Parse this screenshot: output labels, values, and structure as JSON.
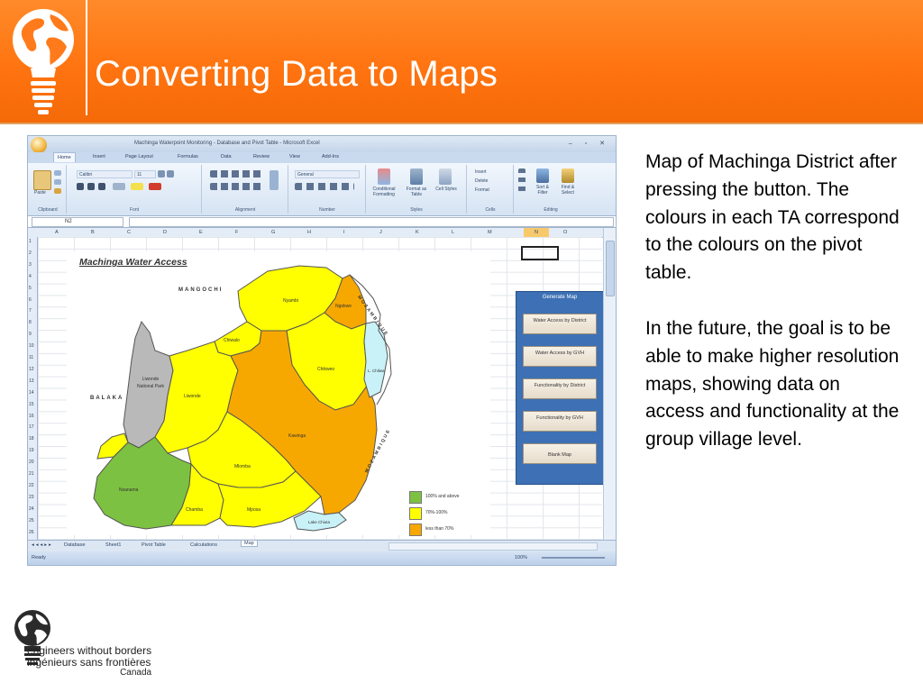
{
  "slide": {
    "title": "Converting Data to Maps",
    "header_color": "#ff7a1a",
    "description_paragraphs": [
      "Map of Machinga District after pressing the button. The colours in each TA correspond to the colours on the pivot table.",
      "In the future, the goal is to be able to make higher resolution maps, showing data on access and functionality at the group village level."
    ]
  },
  "screenshot": {
    "window_title": "Machinga Waterpoint Monitoring - Database and Pivot Table - Microsoft Excel",
    "ribbon_tabs": [
      "Home",
      "Insert",
      "Page Layout",
      "Formulas",
      "Data",
      "Review",
      "View",
      "Add-Ins"
    ],
    "ribbon_groups": [
      "Clipboard",
      "Font",
      "Alignment",
      "Number",
      "Styles",
      "Cells",
      "Editing"
    ],
    "ribbon_buttons": {
      "paste": "Paste",
      "font_name": "Calibri",
      "font_size": "11",
      "number_format": "General",
      "conditional_formatting": "Conditional Formatting",
      "format_as_table": "Format as Table",
      "cell_styles": "Cell Styles",
      "insert": "Insert",
      "delete": "Delete",
      "format": "Format",
      "sort_filter": "Sort & Filter",
      "find_select": "Find & Select"
    },
    "name_box": "N2",
    "columns": [
      "A",
      "B",
      "C",
      "D",
      "E",
      "F",
      "G",
      "H",
      "I",
      "J",
      "K",
      "L",
      "M",
      "N",
      "O"
    ],
    "rows": [
      "1",
      "2",
      "3",
      "4",
      "5",
      "6",
      "7",
      "8",
      "9",
      "10",
      "11",
      "12",
      "13",
      "14",
      "15",
      "16",
      "17",
      "18",
      "19",
      "20",
      "21",
      "22",
      "23",
      "24",
      "25",
      "26"
    ],
    "sheet_tabs": [
      "Database",
      "Sheet1",
      "Pivot Table",
      "Calculations",
      "Map"
    ],
    "active_sheet": "Map",
    "status_left": "Ready",
    "zoom": "100%",
    "map": {
      "title": "Machinga Water Access",
      "regions": [
        "Nyambi",
        "Ngokwe",
        "Chiwalo",
        "Chikweo",
        "Liwonde National Park",
        "Liwonde",
        "Kawinga",
        "Mlomba",
        "Nsanama",
        "Chamba",
        "Mposa"
      ],
      "lake_labels": [
        "L. Chilwa",
        "Lake Chiuta"
      ],
      "surrounding": [
        "MANGOCHI",
        "BALAKA",
        "MOZAMBIQUE",
        "MOZAMBIQUE"
      ],
      "colors": {
        "high": "#7dc142",
        "mid": "#ffff00",
        "low": "#f7a800",
        "park": "#b9b9b9",
        "water": "#c8f2f8"
      },
      "legend": [
        {
          "label": "100% and above",
          "color": "#7dc142"
        },
        {
          "label": "70%-100%",
          "color": "#ffff00"
        },
        {
          "label": "less than 70%",
          "color": "#f7a800"
        }
      ]
    },
    "generate_panel": {
      "title": "Generate Map",
      "buttons": [
        "Water Access by District",
        "Water Access by GVH",
        "Functionality by District",
        "Functionality by GVH",
        "Blank Map"
      ]
    }
  },
  "footer": {
    "line1": "engineers without borders",
    "line2": "ingénieurs sans frontières",
    "line3": "Canada"
  }
}
